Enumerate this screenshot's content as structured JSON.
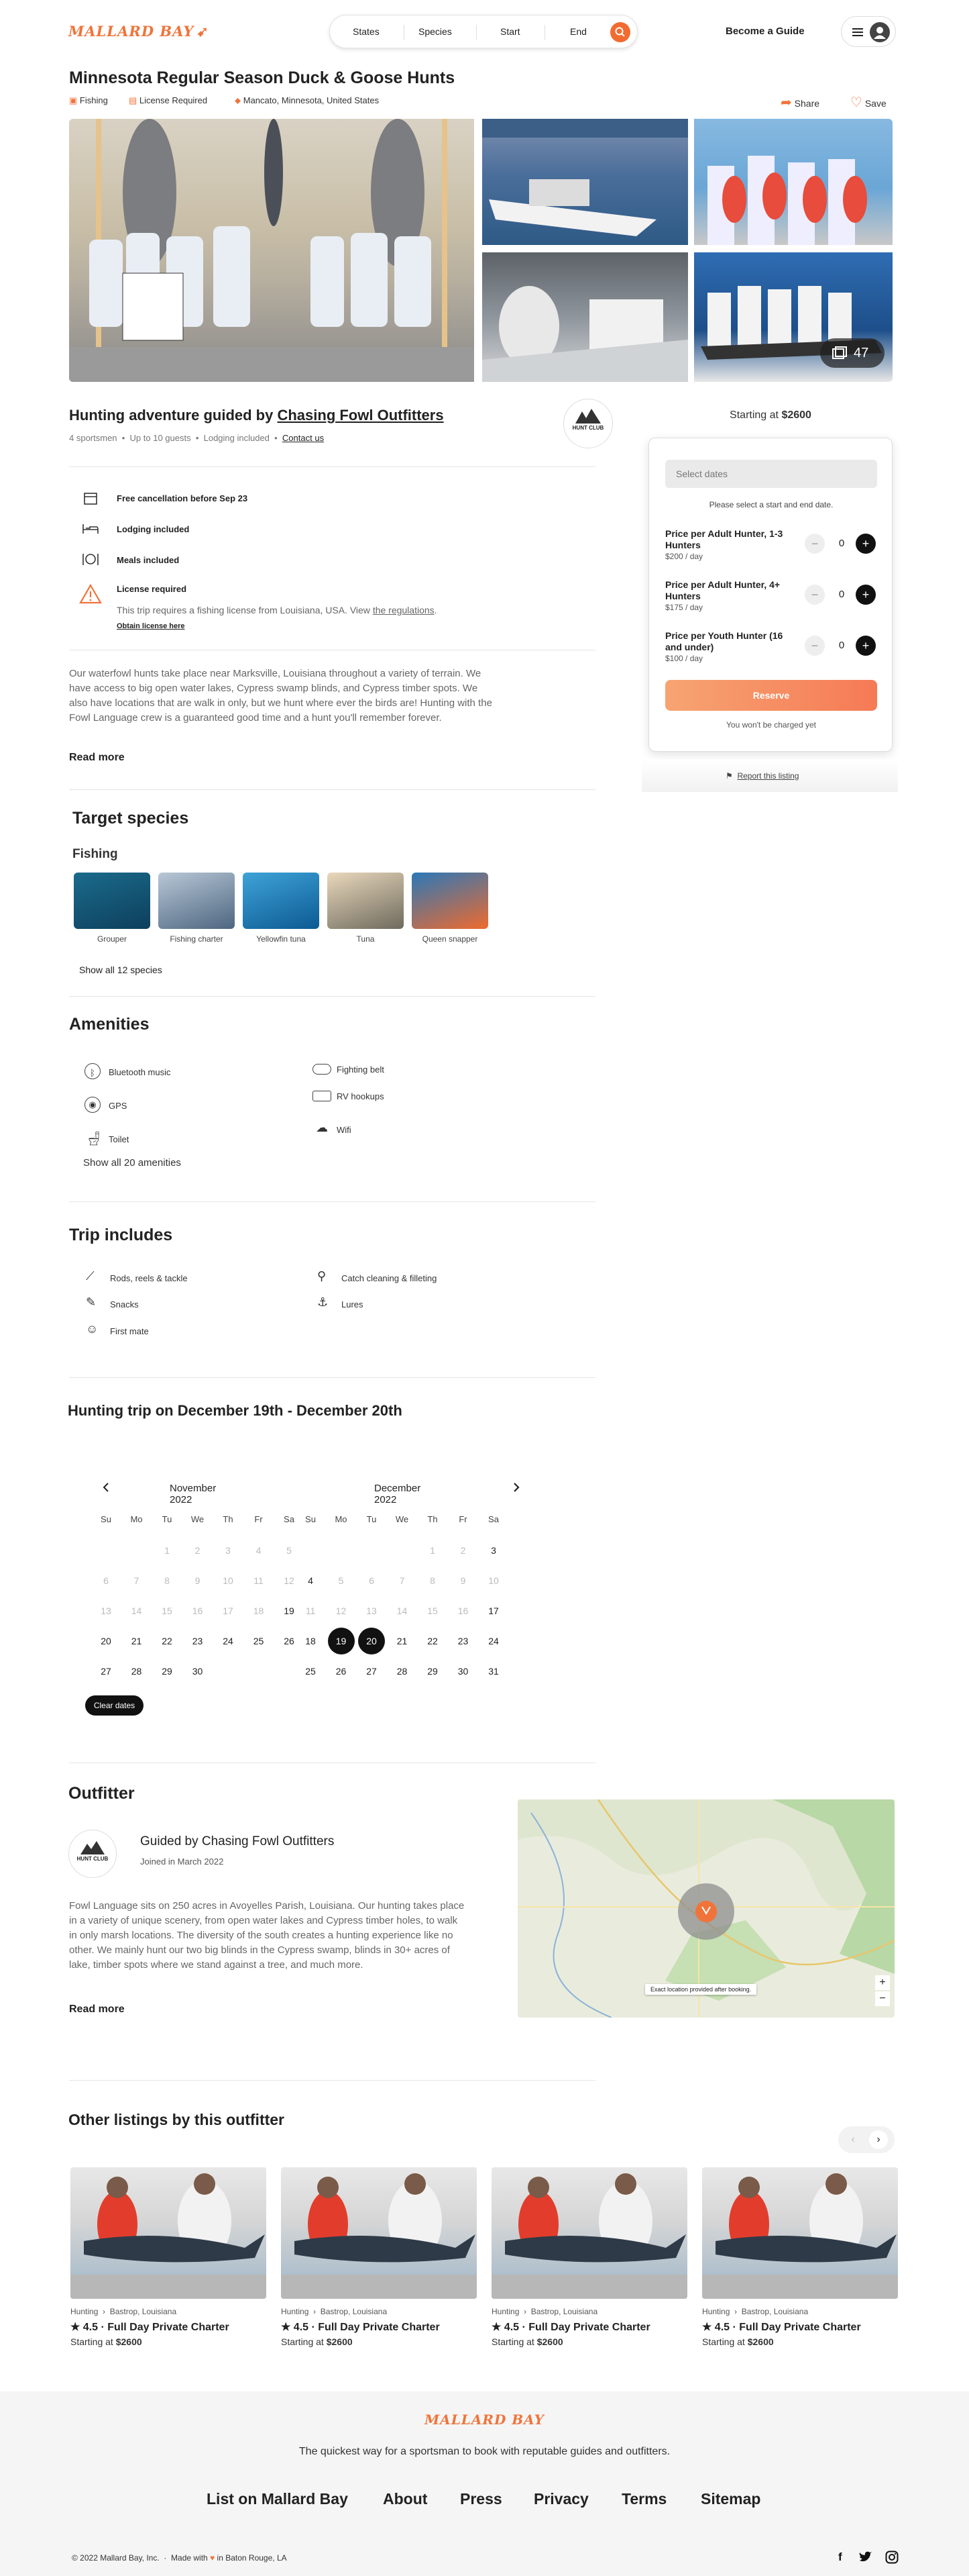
{
  "brand": {
    "name": "MALLARD BAY",
    "accent": "#f0743a"
  },
  "header": {
    "search": {
      "states": "States",
      "species": "Species",
      "start": "Start",
      "end": "End"
    },
    "become_guide": "Become a Guide"
  },
  "listing": {
    "title": "Minnesota Regular Season Duck & Goose Hunts",
    "tags": {
      "activity": "Fishing",
      "license": "License Required",
      "location": "Mancato, Minnesota, United States"
    },
    "actions": {
      "share": "Share",
      "save": "Save"
    },
    "photo_count": "47"
  },
  "overview": {
    "heading_prefix": "Hunting adventure guided by",
    "outfitter": "Chasing Fowl Outfitters",
    "stats": [
      "4 sportsmen",
      "Up to 10 guests",
      "Lodging included"
    ],
    "contact": "Contact us",
    "features": {
      "cancel": "Free cancellation before Sep 23",
      "lodging": "Lodging included",
      "meals": "Meals included",
      "license_title": "License required",
      "license_text": "This trip requires a fishing license from Louisiana, USA. View ",
      "license_link": "the regulations",
      "license_end": ".",
      "license_obtain": "Obtain license here"
    },
    "description": "Our waterfowl hunts take place near Marksville, Louisiana throughout a variety of terrain. We have access to big open water lakes, Cypress swamp blinds, and Cypress timber spots. We also have locations that are walk in only, but we hunt where ever the birds are! Hunting with the Fowl Language crew is a guaranteed good time and a hunt you'll remember forever.",
    "read_more": "Read more"
  },
  "booking": {
    "starting_prefix": "Starting at",
    "starting_price": "$2600",
    "select_dates": "Select dates",
    "hint": "Please select a start and end date.",
    "prices": [
      {
        "label": "Price per Adult Hunter, 1-3 Hunters",
        "sub": "$200 / day",
        "count": "0"
      },
      {
        "label": "Price per Adult Hunter, 4+ Hunters",
        "sub": "$175 / day",
        "count": "0"
      },
      {
        "label": "Price per Youth Hunter (16 and under)",
        "sub": "$100 / day",
        "count": "0"
      }
    ],
    "reserve": "Reserve",
    "no_charge": "You won't be charged yet",
    "report": "Report this listing"
  },
  "species": {
    "heading": "Target species",
    "category": "Fishing",
    "items": [
      "Grouper",
      "Fishing charter",
      "Yellowfin tuna",
      "Tuna",
      "Queen snapper"
    ],
    "show_all": "Show all 12 species"
  },
  "amenities": {
    "heading": "Amenities",
    "items": [
      "Bluetooth music",
      "GPS",
      "Toilet",
      "Fighting belt",
      "RV hookups",
      "Wifi"
    ],
    "show_all": "Show all 20 amenities"
  },
  "includes": {
    "heading": "Trip includes",
    "items": [
      "Rods, reels & tackle",
      "Snacks",
      "First mate",
      "Catch cleaning & filleting",
      "Lures"
    ]
  },
  "calendar": {
    "heading": "Hunting trip on December 19th - December 20th",
    "weekdays": [
      "Su",
      "Mo",
      "Tu",
      "We",
      "Th",
      "Fr",
      "Sa"
    ],
    "months": [
      {
        "name": "November 2022",
        "first_weekday": 2,
        "days": 30,
        "enabled_from": 19
      },
      {
        "name": "December 2022",
        "first_weekday": 4,
        "days": 31,
        "enabled_from": 17,
        "enabled_extra": [
          3,
          4
        ],
        "selected": [
          19,
          20
        ]
      }
    ],
    "clear": "Clear dates"
  },
  "outfitter": {
    "heading": "Outfitter",
    "name": "Guided by Chasing Fowl Outfitters",
    "joined": "Joined in March 2022",
    "logo_text": "HUNT CLUB",
    "bio": "Fowl Language sits on 250 acres in Avoyelles Parish, Louisiana. Our hunting takes place in a variety of unique scenery, from open water lakes and Cypress timber holes, to walk in only marsh locations. The diversity of the south creates a hunting experience like no other. We mainly hunt our two big blinds in the Cypress swamp, blinds in 30+ acres of lake, timber spots where we stand against a tree, and much more.",
    "read_more": "Read more",
    "map_note": "Exact location provided after booking."
  },
  "other": {
    "heading": "Other listings by this outfitter",
    "items": [
      {
        "cat": "Hunting",
        "loc": "Bastrop, Louisiana",
        "rating": "4.5",
        "name": "Full Day Private Charter",
        "price": "$2600"
      },
      {
        "cat": "Hunting",
        "loc": "Bastrop, Louisiana",
        "rating": "4.5",
        "name": "Full Day Private Charter",
        "price": "$2600"
      },
      {
        "cat": "Hunting",
        "loc": "Bastrop, Louisiana",
        "rating": "4.5",
        "name": "Full Day Private Charter",
        "price": "$2600"
      },
      {
        "cat": "Hunting",
        "loc": "Bastrop, Louisiana",
        "rating": "4.5",
        "name": "Full Day Private Charter",
        "price": "$2600"
      }
    ],
    "starting": "Starting at"
  },
  "footer": {
    "tagline": "The quickest way for a sportsman to book with reputable guides and outfitters.",
    "links": [
      "List on Mallard Bay",
      "About",
      "Press",
      "Privacy",
      "Terms",
      "Sitemap"
    ],
    "copyright": "© 2022 Mallard Bay, Inc.",
    "made_with": "Made with",
    "made_in": "in Baton Rouge, LA"
  }
}
